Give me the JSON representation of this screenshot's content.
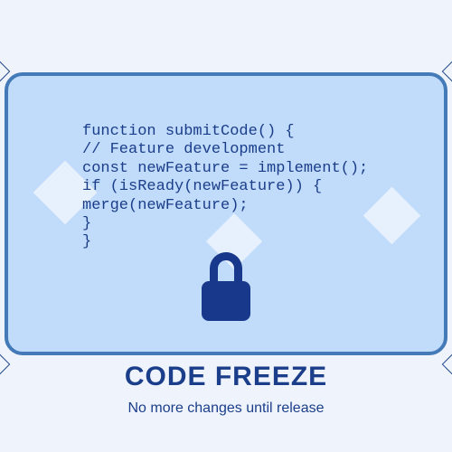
{
  "code": {
    "lines": [
      "function submitCode() {",
      "// Feature development",
      "const newFeature = implement();",
      "if (isReady(newFeature)) {",
      "merge(newFeature);",
      "}",
      "}"
    ]
  },
  "title": "CODE FREEZE",
  "subtitle": "No more changes until release"
}
